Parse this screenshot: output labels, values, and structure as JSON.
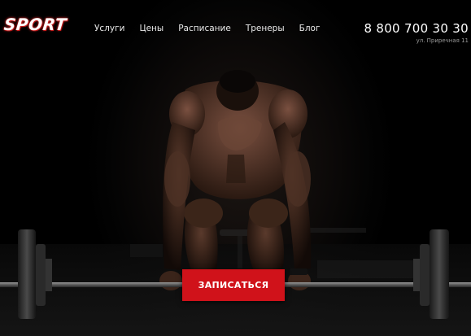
{
  "header": {
    "logo_text": "SPORT",
    "nav": [
      {
        "label": "Услуги"
      },
      {
        "label": "Цены"
      },
      {
        "label": "Расписание"
      },
      {
        "label": "Тренеры"
      },
      {
        "label": "Блог"
      }
    ],
    "phone": "8 800 700 30 30",
    "address": "ул. Приречная 11"
  },
  "hero": {
    "cta_label": "ЗАПИСАТЬСЯ"
  },
  "colors": {
    "accent": "#d0121a",
    "background": "#000000",
    "text": "#ffffff"
  }
}
